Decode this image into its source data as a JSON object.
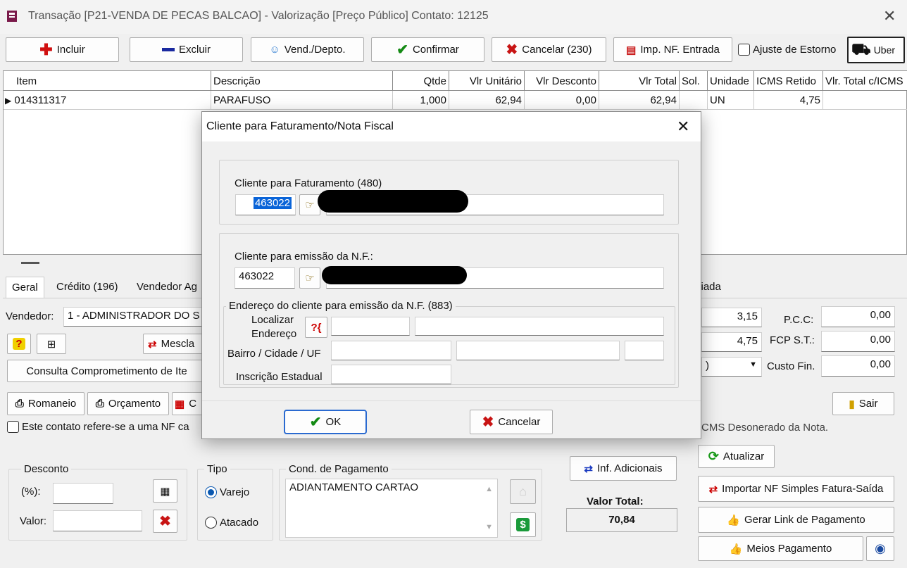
{
  "window": {
    "title": "Transação [P21-VENDA DE PECAS BALCAO] - Valorização [Preço Público]  Contato: 12125",
    "close_glyph": "✕"
  },
  "toolbar": {
    "incluir": "Incluir",
    "excluir": "Excluir",
    "vend_depto": "Vend./Depto.",
    "confirmar": "Confirmar",
    "cancelar": "Cancelar (230)",
    "imp_nf": "Imp. NF. Entrada",
    "ajuste_estorno": "Ajuste de Estorno",
    "uber": "Uber"
  },
  "grid": {
    "columns": [
      "Item",
      "Descrição",
      "Qtde",
      "Vlr Unitário",
      "Vlr Desconto",
      "Vlr Total",
      "Sol.",
      "Unidade",
      "ICMS Retido",
      "Vlr. Total c/ICMS"
    ],
    "rows": [
      {
        "item": "014311317",
        "descricao": "PARAFUSO",
        "qtde": "1,000",
        "vlr_unitario": "62,94",
        "vlr_desconto": "0,00",
        "vlr_total": "62,94",
        "sol": "",
        "unidade": "UN",
        "icms_retido": "4,75",
        "vlr_total_icms": ""
      }
    ]
  },
  "tabs": {
    "geral": "Geral",
    "credito": "Crédito (196)",
    "vendedor": "Vendedor Ag",
    "partial_right": "ciada"
  },
  "left_panel": {
    "vendedor_label": "Vendedor:",
    "vendedor_value": "1 - ADMINISTRADOR DO S",
    "mescla": "Mescla",
    "consulta": "Consulta Comprometimento de Ite",
    "romaneio": "Romaneio",
    "orcamento": "Orçamento",
    "partial_c": "C",
    "nf_checkbox": "Este contato refere-se a uma NF ca"
  },
  "right_panel": {
    "v1": "3,15",
    "pcc_label": "P.C.C:",
    "pcc_value": "0,00",
    "v2": "4,75",
    "fcp_label": "FCP S.T.:",
    "fcp_value": "0,00",
    "combo_partial": ")",
    "custo_label": "Custo Fin.",
    "custo_value": "0,00",
    "sair": "Sair",
    "icms_note": "CMS Desonerado da Nota."
  },
  "desconto": {
    "group": "Desconto",
    "pct_label": "(%):",
    "valor_label": "Valor:"
  },
  "tipo": {
    "group": "Tipo",
    "varejo": "Varejo",
    "atacado": "Atacado",
    "selected": "Varejo"
  },
  "pagamento": {
    "group": "Cond. de Pagamento",
    "value": "ADIANTAMENTO CARTAO"
  },
  "summary": {
    "inf_adicionais": "Inf. Adicionais",
    "valor_total_label": "Valor Total:",
    "valor_total": "70,84"
  },
  "actions": {
    "atualizar": "Atualizar",
    "importar": "Importar NF Simples Fatura-Saída",
    "gerar_link": "Gerar Link de Pagamento",
    "meios": "Meios Pagamento"
  },
  "dialog": {
    "title": "Cliente para Faturamento/Nota Fiscal",
    "faturamento_label": "Cliente para Faturamento (480)",
    "faturamento_code": "463022",
    "emissao_label": "Cliente para emissão da N.F.:",
    "emissao_code": "463022",
    "endereco_group": "Endereço do cliente para emissão da N.F. (883)",
    "localizar": "Localizar",
    "endereco": "Endereço",
    "bairro": "Bairro / Cidade / UF",
    "inscricao": "Inscrição Estadual",
    "ok": "OK",
    "cancelar": "Cancelar"
  }
}
